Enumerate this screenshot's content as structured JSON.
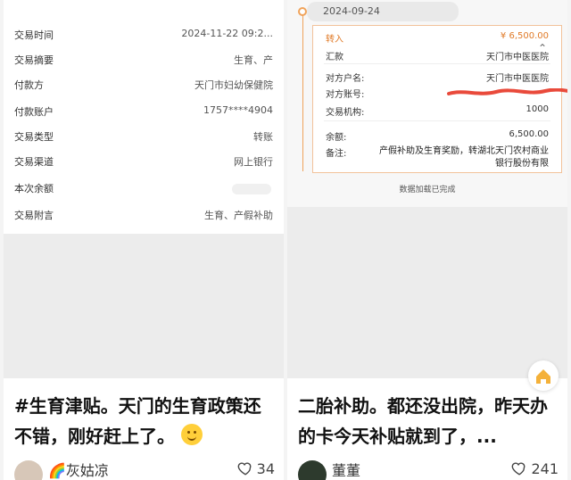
{
  "left_post": {
    "records": [
      {
        "label": "交易时间",
        "value": "2024-11-22 09:2..."
      },
      {
        "label": "交易摘要",
        "value": "生育、产"
      },
      {
        "label": "付款方",
        "value": "天门市妇幼保健院"
      },
      {
        "label": "付款账户",
        "value": "1757****4904"
      },
      {
        "label": "交易类型",
        "value": "转账"
      },
      {
        "label": "交易渠道",
        "value": "网上银行"
      },
      {
        "label": "本次余额",
        "value": ""
      },
      {
        "label": "交易附言",
        "value": "生育、产假补助"
      }
    ],
    "caption_text": "#生育津贴。天门的生育政策还不错，刚好赶上了。",
    "username": "🌈灰姑凉",
    "likes": "34"
  },
  "right_post": {
    "date": "2024-09-24",
    "incoming_label": "转入",
    "incoming_amount": "¥ 6,500.00",
    "transfer_label": "汇款",
    "transfer_value": "天门市中医医院",
    "fields": [
      {
        "label": "对方户名:",
        "value": "天门市中医医院"
      },
      {
        "label": "对方账号:",
        "value": ""
      },
      {
        "label": "交易机构:",
        "value": "1000"
      },
      {
        "label": "余额:",
        "value": "6,500.00"
      }
    ],
    "remark_label": "备注:",
    "remark_value": "产假补助及生育奖励，转湖北天门农村商业银行股份有限",
    "loaded_text": "数据加载已完成",
    "caption_text": "二胎补助。都还没出院，昨天办的卡今天补贴就到了，...",
    "username": "董董",
    "likes": "241"
  },
  "colors": {
    "accent_orange": "#e07a27",
    "scribble_red": "#e94a3b"
  },
  "icons": {
    "heart": "heart-icon",
    "home": "home-icon",
    "chevron": "chevron-up-icon"
  }
}
